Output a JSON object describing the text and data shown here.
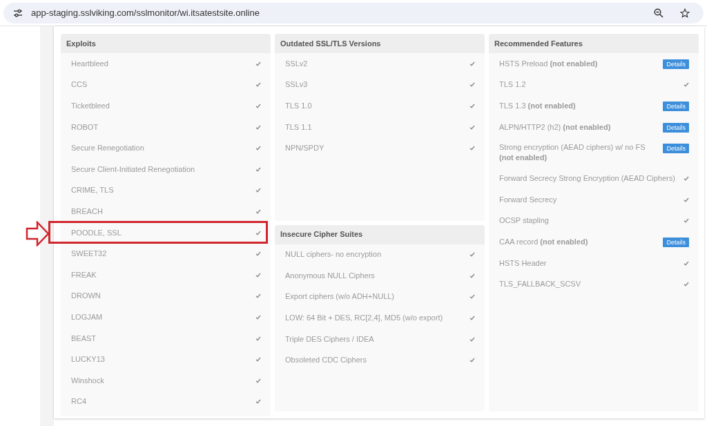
{
  "address_bar": {
    "url": "app-staging.sslviking.com/sslmonitor/wi.itsatestsite.online"
  },
  "columns": [
    {
      "panels": [
        {
          "title": "Exploits",
          "items": [
            {
              "kind": "check",
              "label": "Heartbleed",
              "highlighted": false
            },
            {
              "kind": "check",
              "label": "CCS",
              "highlighted": false
            },
            {
              "kind": "check",
              "label": "Ticketbleed",
              "highlighted": false
            },
            {
              "kind": "check",
              "label": "ROBOT",
              "highlighted": false
            },
            {
              "kind": "check",
              "label": "Secure Renegotiation",
              "highlighted": false
            },
            {
              "kind": "check",
              "label": "Secure Client-Initiated Renegotiation",
              "highlighted": false
            },
            {
              "kind": "check",
              "label": "CRIME, TLS",
              "highlighted": false
            },
            {
              "kind": "check",
              "label": "BREACH",
              "highlighted": false
            },
            {
              "kind": "check",
              "label": "POODLE, SSL",
              "highlighted": true
            },
            {
              "kind": "check",
              "label": "SWEET32",
              "highlighted": false
            },
            {
              "kind": "check",
              "label": "FREAK",
              "highlighted": false
            },
            {
              "kind": "check",
              "label": "DROWN",
              "highlighted": false
            },
            {
              "kind": "check",
              "label": "LOGJAM",
              "highlighted": false
            },
            {
              "kind": "check",
              "label": "BEAST",
              "highlighted": false
            },
            {
              "kind": "check",
              "label": "LUCKY13",
              "highlighted": false
            },
            {
              "kind": "check",
              "label": "Winshock",
              "highlighted": false
            },
            {
              "kind": "check",
              "label": "RC4",
              "highlighted": false
            }
          ]
        }
      ]
    },
    {
      "panels": [
        {
          "title": "Outdated SSL/TLS Versions",
          "items": [
            {
              "kind": "check",
              "label": "SSLv2"
            },
            {
              "kind": "check",
              "label": "SSLv3"
            },
            {
              "kind": "check",
              "label": "TLS 1.0"
            },
            {
              "kind": "check",
              "label": "TLS 1.1"
            },
            {
              "kind": "check",
              "label": "NPN/SPDY"
            }
          ]
        },
        {
          "title": "Insecure Cipher Suites",
          "items": [
            {
              "kind": "check",
              "label": "NULL ciphers- no encryption"
            },
            {
              "kind": "check",
              "label": "Anonymous NULL Ciphers"
            },
            {
              "kind": "check",
              "label": "Export ciphers (w/o ADH+NULL)"
            },
            {
              "kind": "check",
              "label": "LOW: 64 Bit + DES, RC[2,4], MD5 (w/o export)"
            },
            {
              "kind": "check",
              "label": "Triple DES Ciphers / IDEA"
            },
            {
              "kind": "check",
              "label": "Obsoleted CDC Ciphers"
            }
          ]
        }
      ]
    },
    {
      "panels": [
        {
          "title": "Recommended Features",
          "items": [
            {
              "kind": "details",
              "label": "HSTS Preload **(not enabled)**",
              "button": "Details"
            },
            {
              "kind": "check",
              "label": "TLS 1.2"
            },
            {
              "kind": "details",
              "label": "TLS 1.3 **(not enabled)**",
              "button": "Details"
            },
            {
              "kind": "details",
              "label": "ALPN/HTTP2 (h2) **(not enabled)**",
              "button": "Details"
            },
            {
              "kind": "details",
              "label": "Strong encryption (AEAD ciphers) w/ no FS **(not enabled)**",
              "button": "Details"
            },
            {
              "kind": "check",
              "label": "Forward Secrecy Strong Encryption (AEAD Ciphers)"
            },
            {
              "kind": "check",
              "label": "Forward Secrecy"
            },
            {
              "kind": "check",
              "label": "OCSP stapling"
            },
            {
              "kind": "details",
              "label": "CAA record **(not enabled)**",
              "button": "Details"
            },
            {
              "kind": "check",
              "label": "HSTS Header"
            },
            {
              "kind": "check",
              "label": "TLS_FALLBACK_SCSV"
            }
          ]
        }
      ]
    }
  ]
}
